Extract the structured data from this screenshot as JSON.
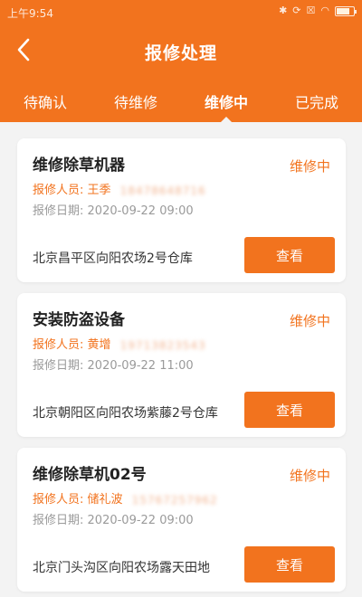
{
  "status_bar": {
    "time": "上午9:54",
    "icons": [
      "bluetooth-icon",
      "sync-off-icon",
      "close-box-icon",
      "wifi-icon",
      "battery-icon"
    ]
  },
  "header": {
    "title": "报修处理",
    "back_icon": "chevron-left-icon"
  },
  "tabs": [
    {
      "label": "待确认",
      "active": false
    },
    {
      "label": "待维修",
      "active": false
    },
    {
      "label": "维修中",
      "active": true
    },
    {
      "label": "已完成",
      "active": false
    }
  ],
  "orders": [
    {
      "title": "维修除草机器",
      "status": "维修中",
      "person_label": "报修人员:",
      "person_name": "王季",
      "person_phone": "18478648716",
      "date_label": "报修日期:",
      "date": "2020-09-22 09:00",
      "address": "北京昌平区向阳农场2号仓库",
      "button": "查看"
    },
    {
      "title": "安装防盗设备",
      "status": "维修中",
      "person_label": "报修人员:",
      "person_name": "黄增",
      "person_phone": "19713823543",
      "date_label": "报修日期:",
      "date": "2020-09-22 11:00",
      "address": "北京朝阳区向阳农场紫藤2号仓库",
      "button": "查看"
    },
    {
      "title": "维修除草机02号",
      "status": "维修中",
      "person_label": "报修人员:",
      "person_name": "储礼波",
      "person_phone": "15767257962",
      "date_label": "报修日期:",
      "date": "2020-09-22 09:00",
      "address": "北京门头沟区向阳农场露天田地",
      "button": "查看"
    }
  ],
  "colors": {
    "accent": "#f2731e",
    "background": "#f3f3f3"
  }
}
